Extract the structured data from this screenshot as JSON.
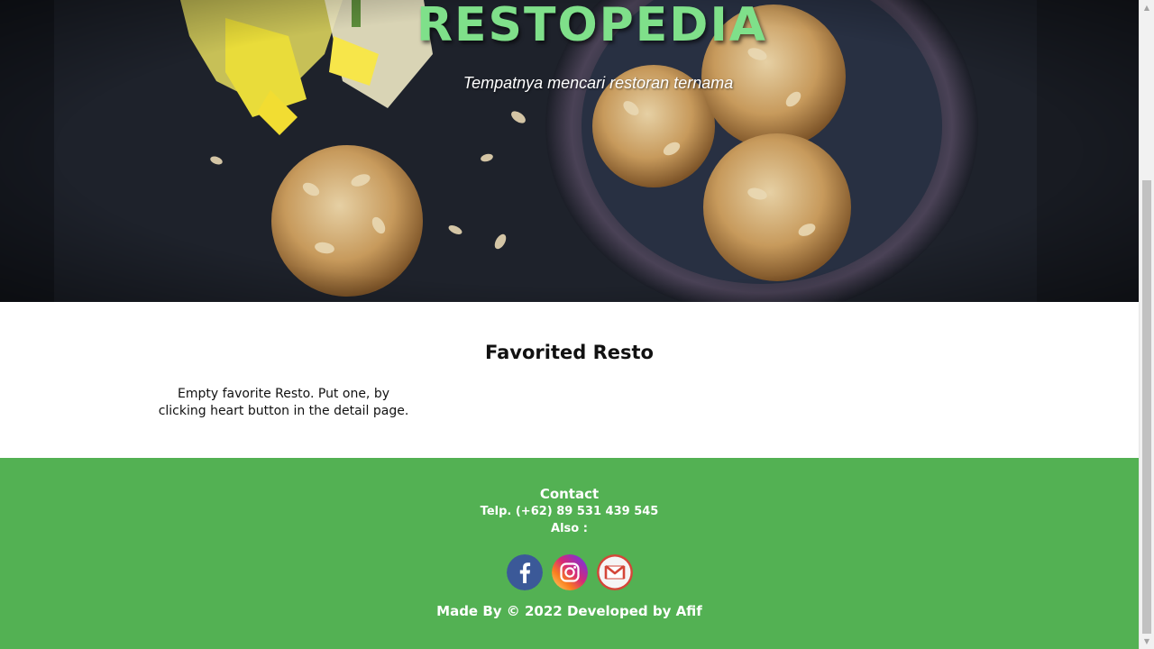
{
  "hero": {
    "title": "RESTOPEDIA",
    "tagline": "Tempatnya mencari restoran ternama"
  },
  "main": {
    "section_title": "Favorited Resto",
    "empty_message": "Empty favorite Resto. Put one, by clicking heart button in the detail page."
  },
  "footer": {
    "contact_title": "Contact",
    "phone": "Telp. (+62) 89 531 439 545",
    "also": "Also :",
    "socials": [
      {
        "icon": "facebook-icon",
        "color": "#3b5998"
      },
      {
        "icon": "instagram-icon",
        "color": "#c13584"
      },
      {
        "icon": "gmail-icon",
        "color": "#d44638"
      }
    ],
    "credit": "Made By © 2022 Developed by Afif"
  },
  "colors": {
    "title_green": "#7fe08a",
    "footer_green": "#53b153"
  }
}
